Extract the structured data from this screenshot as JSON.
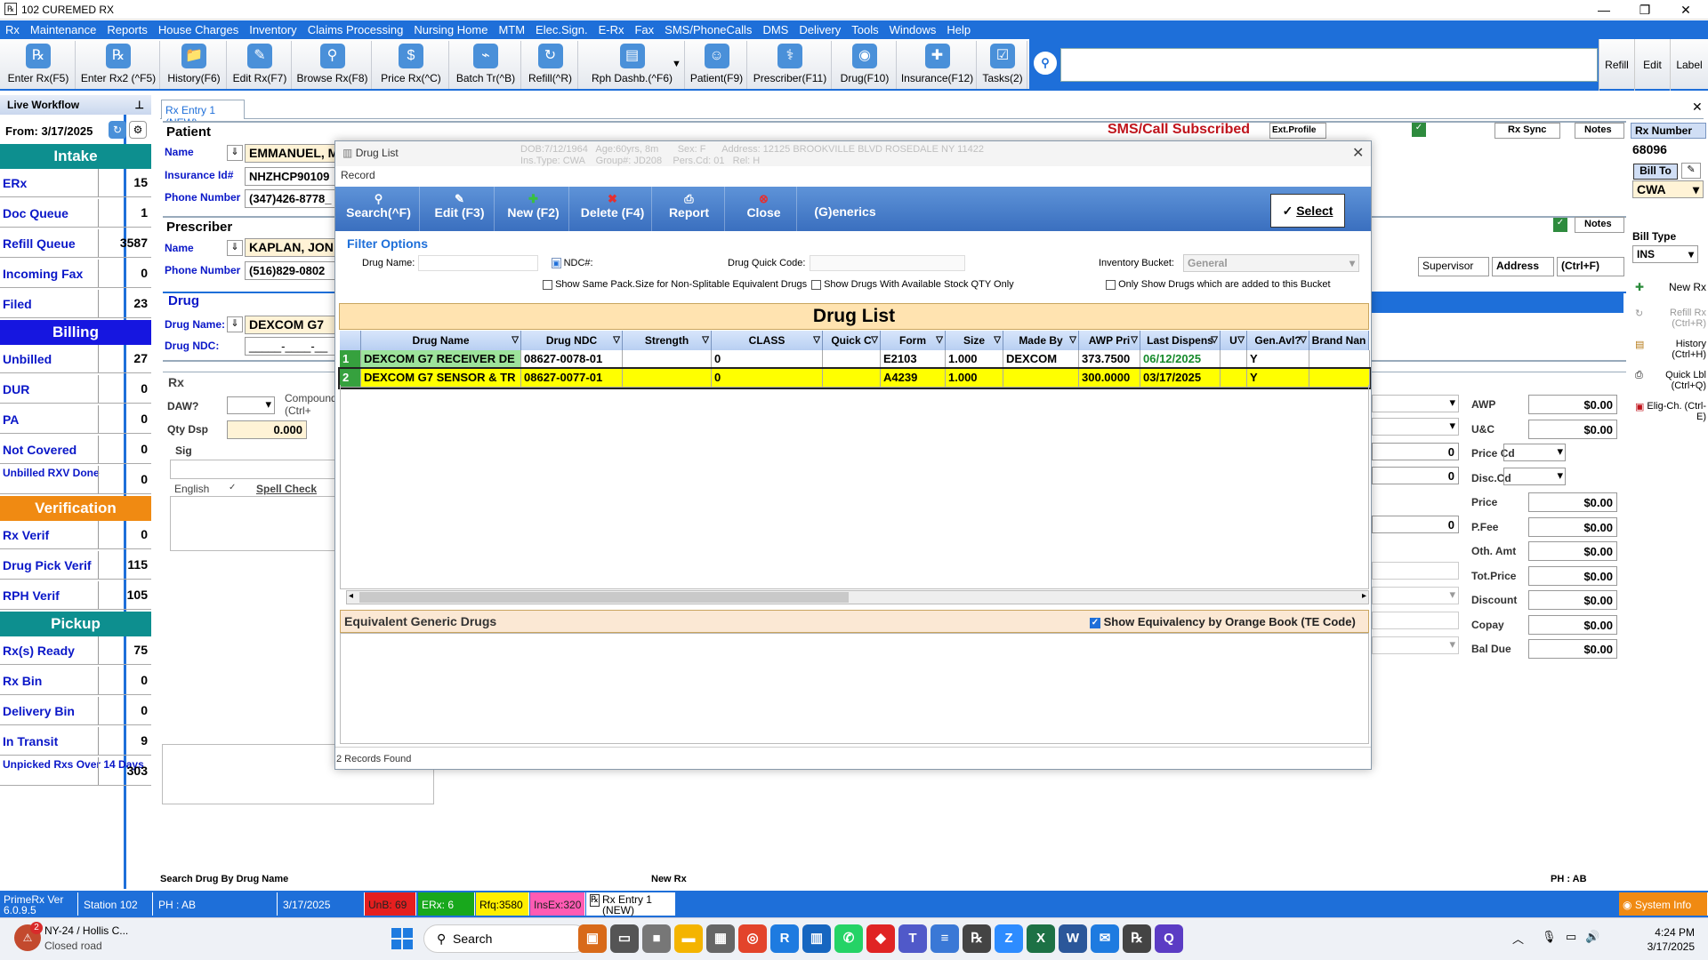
{
  "window": {
    "title": "102 CUREMED RX"
  },
  "menu": [
    "Rx",
    "Maintenance",
    "Reports",
    "House Charges",
    "Inventory",
    "Claims Processing",
    "Nursing Home",
    "MTM",
    "Elec.Sign.",
    "E-Rx",
    "Fax",
    "SMS/PhoneCalls",
    "DMS",
    "Delivery",
    "Tools",
    "Windows",
    "Help"
  ],
  "toolbar": [
    {
      "label": "Enter Rx(F5)",
      "icon": "rx-plus-icon",
      "glyph": "℞"
    },
    {
      "label": "Enter Rx2 (^F5)",
      "icon": "rx2-plus-icon",
      "glyph": "℞"
    },
    {
      "label": "History(F6)",
      "icon": "folder-history-icon",
      "glyph": "📁"
    },
    {
      "label": "Edit Rx(F7)",
      "icon": "pencil-edit-icon",
      "glyph": "✎"
    },
    {
      "label": "Browse Rx(F8)",
      "icon": "magnifier-icon",
      "glyph": "⚲"
    },
    {
      "label": "Price Rx(^C)",
      "icon": "price-tag-icon",
      "glyph": "$"
    },
    {
      "label": "Batch Tr(^B)",
      "icon": "antenna-icon",
      "glyph": "⌁"
    },
    {
      "label": "Refill(^R)",
      "icon": "refill-icon",
      "glyph": "↻"
    },
    {
      "label": "Rph Dashb.(^F6)",
      "icon": "dashboard-icon",
      "glyph": "▤"
    },
    {
      "label": "Patient(F9)",
      "icon": "patient-icon",
      "glyph": "☺"
    },
    {
      "label": "Prescriber(F11)",
      "icon": "doctor-icon",
      "glyph": "⚕"
    },
    {
      "label": "Drug(F10)",
      "icon": "pill-icon",
      "glyph": "◉"
    },
    {
      "label": "Insurance(F12)",
      "icon": "shield-icon",
      "glyph": "✚"
    },
    {
      "label": "Tasks(2)",
      "icon": "tasks-icon",
      "glyph": "☑"
    }
  ],
  "toolbar_right": [
    "Refill",
    "Edit",
    "Label"
  ],
  "left_panel": {
    "header": "Live Workflow",
    "from_label": "From:",
    "from_date": "3/17/2025",
    "sections": [
      {
        "title": "Intake",
        "color": "#0d8f8f",
        "rows": [
          {
            "label": "ERx",
            "value": "15"
          },
          {
            "label": "Doc Queue",
            "value": "1"
          },
          {
            "label": "Refill Queue",
            "value": "3587"
          },
          {
            "label": "Incoming Fax",
            "value": "0"
          },
          {
            "label": "Filed",
            "value": "23"
          }
        ]
      },
      {
        "title": "Billing",
        "color": "#1616e0",
        "rows": [
          {
            "label": "Unbilled",
            "value": "27"
          },
          {
            "label": "DUR",
            "value": "0"
          },
          {
            "label": "PA",
            "value": "0"
          },
          {
            "label": "Not Covered",
            "value": "0"
          },
          {
            "label": "Unbilled RXV Done",
            "value": "0"
          }
        ]
      },
      {
        "title": "Verification",
        "color": "#f08a12",
        "rows": [
          {
            "label": "Rx Verif",
            "value": "0"
          },
          {
            "label": "Drug Pick Verif",
            "value": "115"
          },
          {
            "label": "RPH Verif",
            "value": "105"
          }
        ]
      },
      {
        "title": "Pickup",
        "color": "#0d8f8f",
        "rows": [
          {
            "label": "Rx(s) Ready",
            "value": "75"
          },
          {
            "label": "Rx Bin",
            "value": "0"
          },
          {
            "label": "Delivery Bin",
            "value": "0"
          },
          {
            "label": "In Transit",
            "value": "9"
          },
          {
            "label": "Unpicked Rxs Over 14 Days",
            "value": "303"
          }
        ]
      }
    ]
  },
  "tab": {
    "label": "Rx Entry 1 (NEW)"
  },
  "patient": {
    "section": "Patient",
    "name_label": "Name",
    "name": "EMMANUEL, M",
    "ins_label": "Insurance Id#",
    "ins": "NHZHCP90109",
    "phone_label": "Phone Number",
    "phone": "(347)426-8778_",
    "sms": "SMS/Call Subscribed",
    "ext_profile": "Ext.Profile",
    "rx_sync": "Rx Sync",
    "notes": "Notes"
  },
  "prescriber": {
    "section": "Prescriber",
    "name_label": "Name",
    "name": "KAPLAN, JON",
    "phone_label": "Phone Number",
    "phone": "(516)829-0802",
    "notes": "Notes",
    "supervisor": "Supervisor",
    "address": "Address",
    "ctrlf": "(Ctrl+F)"
  },
  "drug": {
    "section": "Drug",
    "name_label": "Drug Name:",
    "name": "DEXCOM G7",
    "ndc_label": "Drug NDC:",
    "ndc": "_____-____-__"
  },
  "rx": {
    "section": "Rx",
    "daw": "DAW?",
    "compound": "Compound (Ctrl+",
    "qty": "Qty Dsp",
    "qty_val": "0.000",
    "sig": "Sig",
    "english": "English",
    "spell": "Spell Check"
  },
  "right_panel": {
    "rx_number_label": "Rx Number",
    "rx_number": "68096",
    "bill_to": "Bill To",
    "bill_val": "CWA",
    "bill_type_label": "Bill Type",
    "bill_type": "INS",
    "new_rx": "New Rx",
    "refill_rx": "Refill Rx (Ctrl+R)",
    "history": "History (Ctrl+H)",
    "quick_lbl": "Quick Lbl (Ctrl+Q)",
    "elig": "Elig-Ch. (Ctrl-E)"
  },
  "pricing": [
    {
      "label": "AWP",
      "value": "$0.00"
    },
    {
      "label": "U&C",
      "value": "$0.00"
    },
    {
      "label": "Price Cd",
      "value": ""
    },
    {
      "label": "Disc.Cd",
      "value": ""
    },
    {
      "label": "Price",
      "value": "$0.00"
    },
    {
      "label": "P.Fee",
      "value": "$0.00"
    },
    {
      "label": "Oth. Amt",
      "value": "$0.00"
    },
    {
      "label": "Tot.Price",
      "value": "$0.00"
    },
    {
      "label": "Discount",
      "value": "$0.00"
    },
    {
      "label": "Copay",
      "value": "$0.00"
    },
    {
      "label": "Bal Due",
      "value": "$0.00"
    }
  ],
  "mid_fields": {
    "a": "0",
    "b": "0",
    "c": "0"
  },
  "dialog": {
    "title": "Drug List",
    "record_label": "Record",
    "buttons": [
      {
        "label": "Search(^F)",
        "icon": "search-icon",
        "glyph": "⚲"
      },
      {
        "label": "Edit (F3)",
        "icon": "edit-icon",
        "glyph": "✎"
      },
      {
        "label": "New (F2)",
        "icon": "new-icon",
        "glyph": "✚"
      },
      {
        "label": "Delete (F4)",
        "icon": "delete-icon",
        "glyph": "✖"
      },
      {
        "label": "Report",
        "icon": "printer-icon",
        "glyph": "⎙"
      },
      {
        "label": "Close",
        "icon": "close-icon",
        "glyph": "⊗"
      }
    ],
    "generics_btn": "(G)enerics",
    "select_btn": "Select",
    "filter_title": "Filter Options",
    "drug_name_label": "Drug Name:",
    "ndc_label": "NDC#:",
    "quick_code_label": "Drug Quick Code:",
    "bucket_label": "Inventory Bucket:",
    "bucket_value": "General",
    "chk1": "Show Same Pack.Size for Non-Splitable Equivalent Drugs",
    "chk2": "Show Drugs With Available Stock QTY Only",
    "chk3": "Only Show Drugs which are added to this Bucket",
    "grid_title": "Drug List",
    "columns": [
      "",
      "Drug Name",
      "Drug NDC",
      "Strength",
      "CLASS",
      "Quick C",
      "Form",
      "Size",
      "Made By",
      "AWP Pri",
      "Last Dispens",
      "U",
      "Gen.Avl?",
      "Brand Nan"
    ],
    "rows": [
      [
        "1",
        "DEXCOM G7 RECEIVER DE",
        "08627-0078-01",
        "",
        "0",
        "",
        "E2103",
        "1.000",
        "DEXCOM",
        "373.7500",
        "06/12/2025",
        "",
        "Y",
        ""
      ],
      [
        "2",
        "DEXCOM G7 SENSOR & TR",
        "08627-0077-01",
        "",
        "0",
        "",
        "A4239",
        "1.000",
        "",
        "300.0000",
        "03/17/2025",
        "",
        "Y",
        ""
      ]
    ],
    "generic_title": "Equivalent Generic Drugs",
    "orange_book": "Show Equivalency by Orange Book (TE Code)",
    "records": "2 Records Found"
  },
  "status_line": {
    "left": "Search Drug By Drug Name",
    "mid": "New Rx",
    "right": "PH : AB"
  },
  "statusbar": {
    "version": "PrimeRx Ver 6.0.9.5",
    "station": "Station 102",
    "ph": "PH : AB",
    "date": "3/17/2025",
    "unb": "UnB: 69",
    "erx": "ERx: 6",
    "rfq": "Rfq:3580",
    "insex": "InsEx:320",
    "rxentry": "Rx Entry 1 (NEW)",
    "sysinfo": "System Info"
  },
  "taskbar": {
    "weather_temp": "2",
    "weather_line1": "NY-24 / Hollis C...",
    "weather_line2": "Closed road",
    "search": "Search",
    "time": "4:24 PM",
    "date": "3/17/2025"
  }
}
